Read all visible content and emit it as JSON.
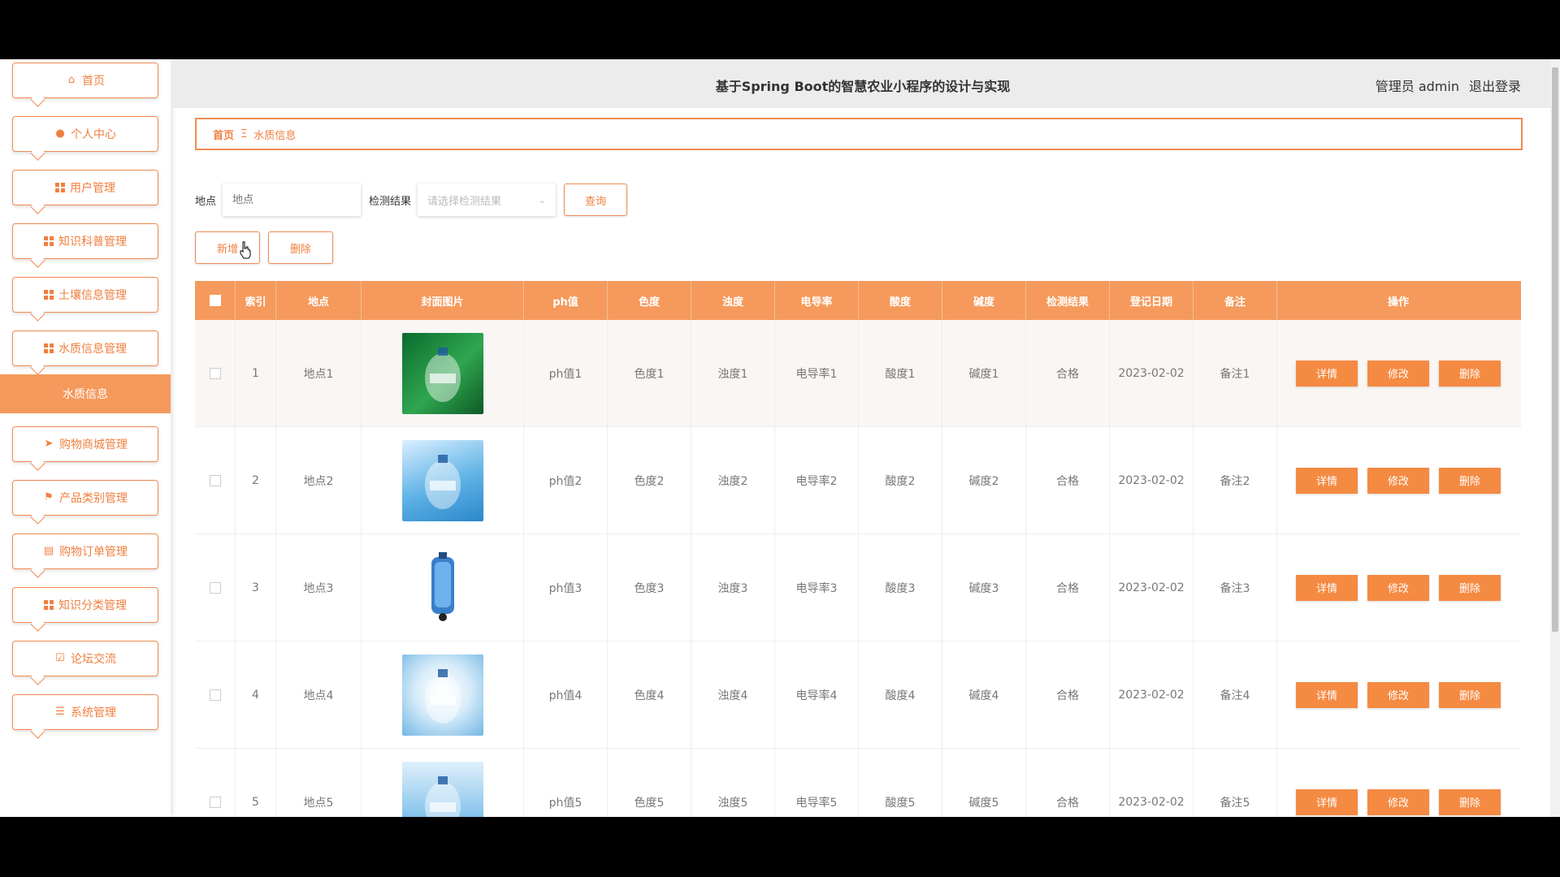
{
  "header": {
    "title": "基于Spring Boot的智慧农业小程序的设计与实现",
    "user": "管理员 admin",
    "logout": "退出登录"
  },
  "sidebar": {
    "items": [
      {
        "label": "首页",
        "icon": "home-icon"
      },
      {
        "label": "个人中心",
        "icon": "user-icon"
      },
      {
        "label": "用户管理",
        "icon": "grid-icon"
      },
      {
        "label": "知识科普管理",
        "icon": "grid-icon"
      },
      {
        "label": "土壤信息管理",
        "icon": "grid-icon"
      },
      {
        "label": "水质信息管理",
        "icon": "grid-icon"
      },
      {
        "label": "购物商城管理",
        "icon": "send-icon"
      },
      {
        "label": "产品类别管理",
        "icon": "flag-icon"
      },
      {
        "label": "购物订单管理",
        "icon": "clipboard-icon"
      },
      {
        "label": "知识分类管理",
        "icon": "grid-icon"
      },
      {
        "label": "论坛交流",
        "icon": "checklist-icon"
      },
      {
        "label": "系统管理",
        "icon": "list-icon"
      }
    ],
    "active_sub": "水质信息"
  },
  "breadcrumb": {
    "home": "首页",
    "separator": "Ξ",
    "current": "水质信息"
  },
  "search": {
    "location_label": "地点",
    "location_placeholder": "地点",
    "result_label": "检测结果",
    "result_placeholder": "请选择检测结果",
    "query_button": "查询"
  },
  "actions": {
    "add": "新增",
    "delete": "删除"
  },
  "table": {
    "columns": [
      "索引",
      "地点",
      "封面图片",
      "ph值",
      "色度",
      "浊度",
      "电导率",
      "酸度",
      "碱度",
      "检测结果",
      "登记日期",
      "备注",
      "操作"
    ],
    "rows": [
      {
        "index": "1",
        "location": "地点1",
        "ph": "ph值1",
        "color": "色度1",
        "turbidity": "浊度1",
        "conductivity": "电导率1",
        "acidity": "酸度1",
        "alkalinity": "碱度1",
        "result": "合格",
        "date": "2023-02-02",
        "note": "备注1"
      },
      {
        "index": "2",
        "location": "地点2",
        "ph": "ph值2",
        "color": "色度2",
        "turbidity": "浊度2",
        "conductivity": "电导率2",
        "acidity": "酸度2",
        "alkalinity": "碱度2",
        "result": "合格",
        "date": "2023-02-02",
        "note": "备注2"
      },
      {
        "index": "3",
        "location": "地点3",
        "ph": "ph值3",
        "color": "色度3",
        "turbidity": "浊度3",
        "conductivity": "电导率3",
        "acidity": "酸度3",
        "alkalinity": "碱度3",
        "result": "合格",
        "date": "2023-02-02",
        "note": "备注3"
      },
      {
        "index": "4",
        "location": "地点4",
        "ph": "ph值4",
        "color": "色度4",
        "turbidity": "浊度4",
        "conductivity": "电导率4",
        "acidity": "酸度4",
        "alkalinity": "碱度4",
        "result": "合格",
        "date": "2023-02-02",
        "note": "备注4"
      },
      {
        "index": "5",
        "location": "地点5",
        "ph": "ph值5",
        "color": "色度5",
        "turbidity": "浊度5",
        "conductivity": "电导率5",
        "acidity": "酸度5",
        "alkalinity": "碱度5",
        "result": "合格",
        "date": "2023-02-02",
        "note": "备注5"
      }
    ],
    "op_labels": {
      "detail": "详情",
      "edit": "修改",
      "delete": "删除"
    }
  },
  "colors": {
    "accent": "#f59a5c",
    "button": "#f58a42",
    "border": "#f08a52"
  }
}
